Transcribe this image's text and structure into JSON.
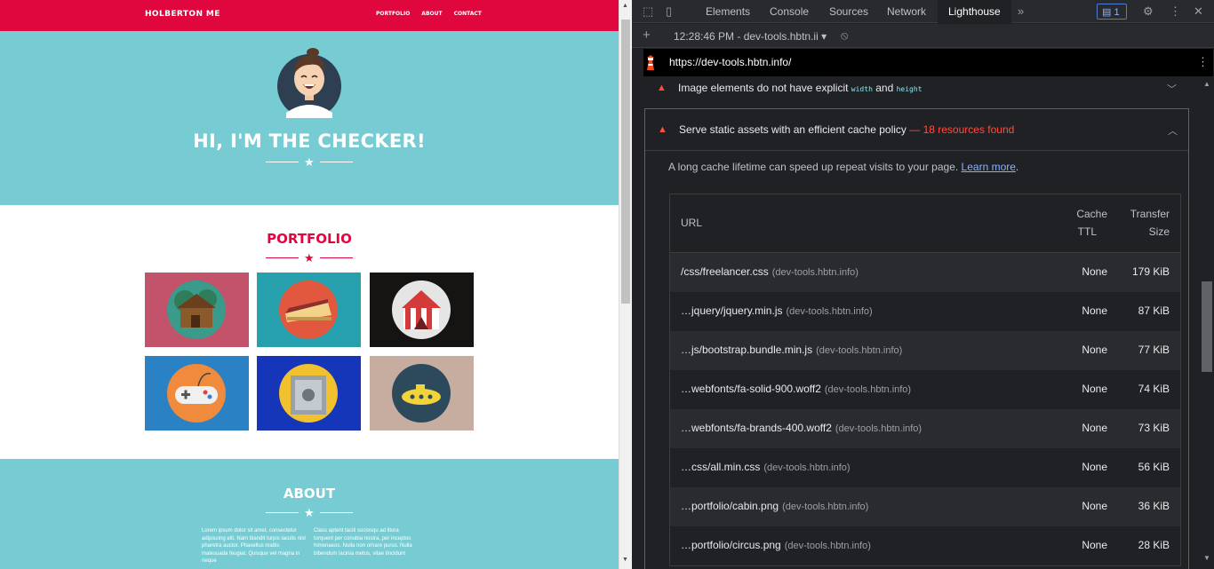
{
  "site": {
    "brand": "HOLBERTON ME",
    "nav": [
      "PORTFOLIO",
      "ABOUT",
      "CONTACT"
    ],
    "hero_title": "HI, I'M THE CHECKER!",
    "portfolio_title": "PORTFOLIO",
    "about_title": "ABOUT",
    "about_col1": "Lorem ipsum dolor sit amet, consectetur adipiscing elit. Nam blandit turpis iaculis nisl pharetra auctor. Phasellus mattis malesuada feugiat. Quisque vel magna in neque",
    "about_col2": "Class aptent taciti sociosqu ad litora torquent per conubia nostra, per inceptos himenaeos. Nulla non ornare purus. Nulla bibendum lacinia metus, vitae tincidunt",
    "tiles": [
      {
        "name": "cabin",
        "bg": "#c2536a",
        "circle": "#3a9b8a"
      },
      {
        "name": "cake",
        "bg": "#26a0ad",
        "circle": "#e2583e"
      },
      {
        "name": "circus",
        "bg": "#161413",
        "circle": "#e5e5e5"
      },
      {
        "name": "game",
        "bg": "#2a82c4",
        "circle": "#f08a3d"
      },
      {
        "name": "safe",
        "bg": "#1536b8",
        "circle": "#f2c12e"
      },
      {
        "name": "submarine",
        "bg": "#c7ada0",
        "circle": "#2c4a5c"
      }
    ],
    "colors": {
      "primary": "#e0073f",
      "teal": "#77ccd4"
    }
  },
  "devtools": {
    "tabs": [
      "Elements",
      "Console",
      "Sources",
      "Network",
      "Lighthouse"
    ],
    "active_tab": "Lighthouse",
    "messages_count": "1",
    "report_selector": "12:28:46 PM - dev-tools.hbtn.ii",
    "url": "https://dev-tools.hbtn.info/",
    "audit1": {
      "pre": "Image elements do not have explicit",
      "code1": "width",
      "mid": "and",
      "code2": "height"
    },
    "audit2": {
      "title": "Serve static assets with an efficient cache policy",
      "found": "— 18 resources found",
      "desc": "A long cache lifetime can speed up repeat visits to your page.",
      "link": "Learn more",
      "period": "."
    },
    "table": {
      "h_url": "URL",
      "h_ttl1": "Cache",
      "h_ttl2": "TTL",
      "h_size1": "Transfer",
      "h_size2": "Size",
      "rows": [
        {
          "url": "/css/freelancer.css",
          "host": "(dev-tools.hbtn.info)",
          "ttl": "None",
          "size": "179 KiB"
        },
        {
          "url": "…jquery/jquery.min.js",
          "host": "(dev-tools.hbtn.info)",
          "ttl": "None",
          "size": "87 KiB"
        },
        {
          "url": "…js/bootstrap.bundle.min.js",
          "host": "(dev-tools.hbtn.info)",
          "ttl": "None",
          "size": "77 KiB"
        },
        {
          "url": "…webfonts/fa-solid-900.woff2",
          "host": "(dev-tools.hbtn.info)",
          "ttl": "None",
          "size": "74 KiB"
        },
        {
          "url": "…webfonts/fa-brands-400.woff2",
          "host": "(dev-tools.hbtn.info)",
          "ttl": "None",
          "size": "73 KiB"
        },
        {
          "url": "…css/all.min.css",
          "host": "(dev-tools.hbtn.info)",
          "ttl": "None",
          "size": "56 KiB"
        },
        {
          "url": "…portfolio/cabin.png",
          "host": "(dev-tools.hbtn.info)",
          "ttl": "None",
          "size": "36 KiB"
        },
        {
          "url": "…portfolio/circus.png",
          "host": "(dev-tools.hbtn.info)",
          "ttl": "None",
          "size": "28 KiB"
        }
      ]
    }
  }
}
